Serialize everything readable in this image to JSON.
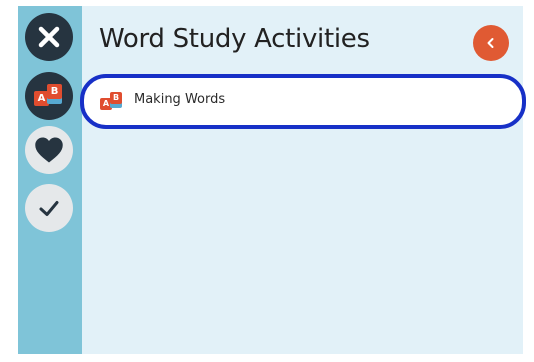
{
  "panel": {
    "title": "Word Study Activities"
  },
  "rail": {
    "buttons": [
      {
        "id": "close",
        "icon": "close-icon"
      },
      {
        "id": "word-study",
        "icon": "ab-letters-icon",
        "tiles": [
          "A",
          "B"
        ]
      },
      {
        "id": "favorites",
        "icon": "heart-icon"
      },
      {
        "id": "completed",
        "icon": "checkmark-icon"
      }
    ]
  },
  "activities": [
    {
      "label": "Making Words",
      "icon": "ab-letters-icon",
      "tiles": [
        "A",
        "B"
      ],
      "focused": true
    }
  ],
  "colors": {
    "rail": "#7fc4d8",
    "panel": "#e2f1f8",
    "dark_button": "#263440",
    "light_button": "#e5e8ea",
    "accent": "#e05a33",
    "focus_ring": "#1730c7",
    "tile_red": "#e04d2f",
    "tile_blue": "#57a9d1"
  }
}
